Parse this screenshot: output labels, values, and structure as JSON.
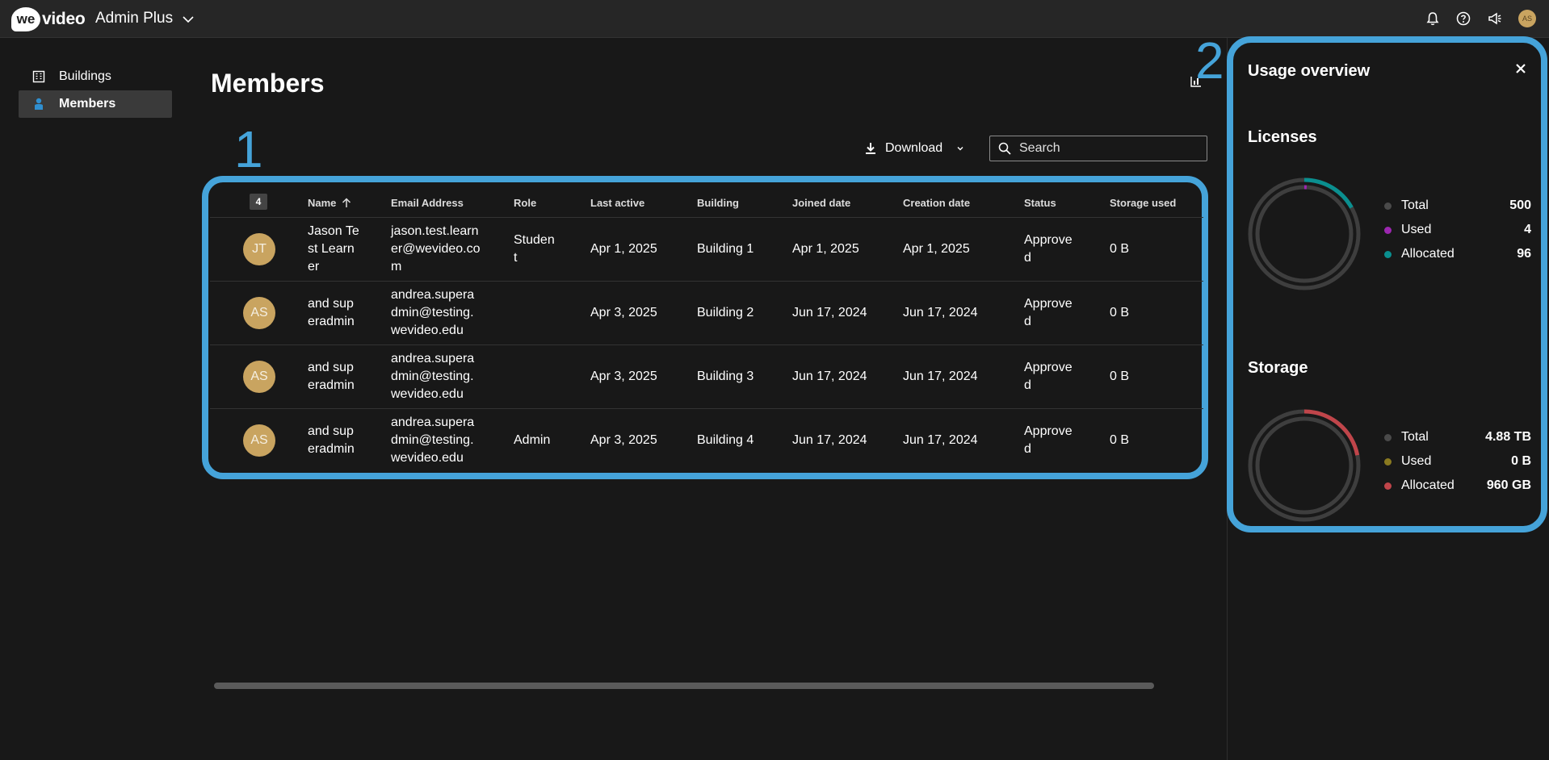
{
  "header": {
    "logo_we": "we",
    "logo_video": "video",
    "plan_name": "Admin Plus",
    "user_initials": "AS"
  },
  "sidebar": {
    "items": [
      {
        "label": "Buildings",
        "icon": "building-icon"
      },
      {
        "label": "Members",
        "icon": "person-icon",
        "active": true
      }
    ]
  },
  "main": {
    "title": "Members",
    "download_label": "Download",
    "search_placeholder": "Search",
    "annotations": [
      "1",
      "2"
    ]
  },
  "table": {
    "count": "4",
    "columns": [
      "Name",
      "Email Address",
      "Role",
      "Last active",
      "Building",
      "Joined date",
      "Creation date",
      "Status",
      "Storage used"
    ],
    "rows": [
      {
        "initials": "JT",
        "name": "Jason Te\nst Learn\ner",
        "email": "jason.test.learn\ner@wevideo.co\nm",
        "role": "Studen\nt",
        "last_active": "Apr 1, 2025",
        "building": "Building 1",
        "joined": "Apr 1, 2025",
        "created": "Apr 1, 2025",
        "status": "Approve\nd",
        "storage": "0 B"
      },
      {
        "initials": "AS",
        "name": "and sup\neradmin",
        "email": "andrea.supera\ndmin@testing.\nwevideo.edu",
        "role": "",
        "last_active": "Apr 3, 2025",
        "building": "Building 2",
        "joined": "Jun 17, 2024",
        "created": "Jun 17, 2024",
        "status": "Approve\nd",
        "storage": "0 B"
      },
      {
        "initials": "AS",
        "name": "and sup\neradmin",
        "email": "andrea.supera\ndmin@testing.\nwevideo.edu",
        "role": "",
        "last_active": "Apr 3, 2025",
        "building": "Building 3",
        "joined": "Jun 17, 2024",
        "created": "Jun 17, 2024",
        "status": "Approve\nd",
        "storage": "0 B"
      },
      {
        "initials": "AS",
        "name": "and sup\neradmin",
        "email": "andrea.supera\ndmin@testing.\nwevideo.edu",
        "role": "Admin",
        "last_active": "Apr 3, 2025",
        "building": "Building 4",
        "joined": "Jun 17, 2024",
        "created": "Jun 17, 2024",
        "status": "Approve\nd",
        "storage": "0 B"
      }
    ]
  },
  "usage": {
    "title": "Usage overview",
    "licenses": {
      "title": "Licenses",
      "items": [
        {
          "label": "Total",
          "value": "500",
          "color": "#4a4a4a"
        },
        {
          "label": "Used",
          "value": "4",
          "color": "#9c27b0"
        },
        {
          "label": "Allocated",
          "value": "96",
          "color": "#0a8f8f"
        }
      ]
    },
    "storage": {
      "title": "Storage",
      "items": [
        {
          "label": "Total",
          "value": "4.88 TB",
          "color": "#4a4a4a"
        },
        {
          "label": "Used",
          "value": "0 B",
          "color": "#8a7a20"
        },
        {
          "label": "Allocated",
          "value": "960 GB",
          "color": "#c0454a"
        }
      ]
    }
  },
  "colors": {
    "accent": "#45a3d9",
    "avatar": "#c9a460",
    "licenses_allocated": "#0a8f8f",
    "storage_allocated": "#c0454a"
  }
}
